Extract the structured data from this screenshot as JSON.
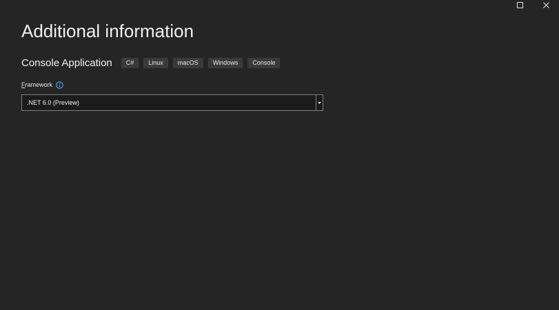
{
  "window": {
    "maximize_icon": "maximize-icon",
    "close_icon": "close-icon"
  },
  "page": {
    "title": "Additional information"
  },
  "template": {
    "name": "Console Application",
    "tags": [
      "C#",
      "Linux",
      "macOS",
      "Windows",
      "Console"
    ]
  },
  "framework": {
    "label_access_key": "F",
    "label_rest": "ramework",
    "info_icon": "info-icon",
    "selected": ".NET 6.0 (Preview)",
    "dropdown_icon": "chevron-down-icon"
  },
  "colors": {
    "background": "#252526",
    "text": "#f1f1f1",
    "tag_background": "#3a3a3d",
    "input_background": "#1b1b1c",
    "input_border": "#7f7f84",
    "info_accent": "#4ea3e6"
  }
}
